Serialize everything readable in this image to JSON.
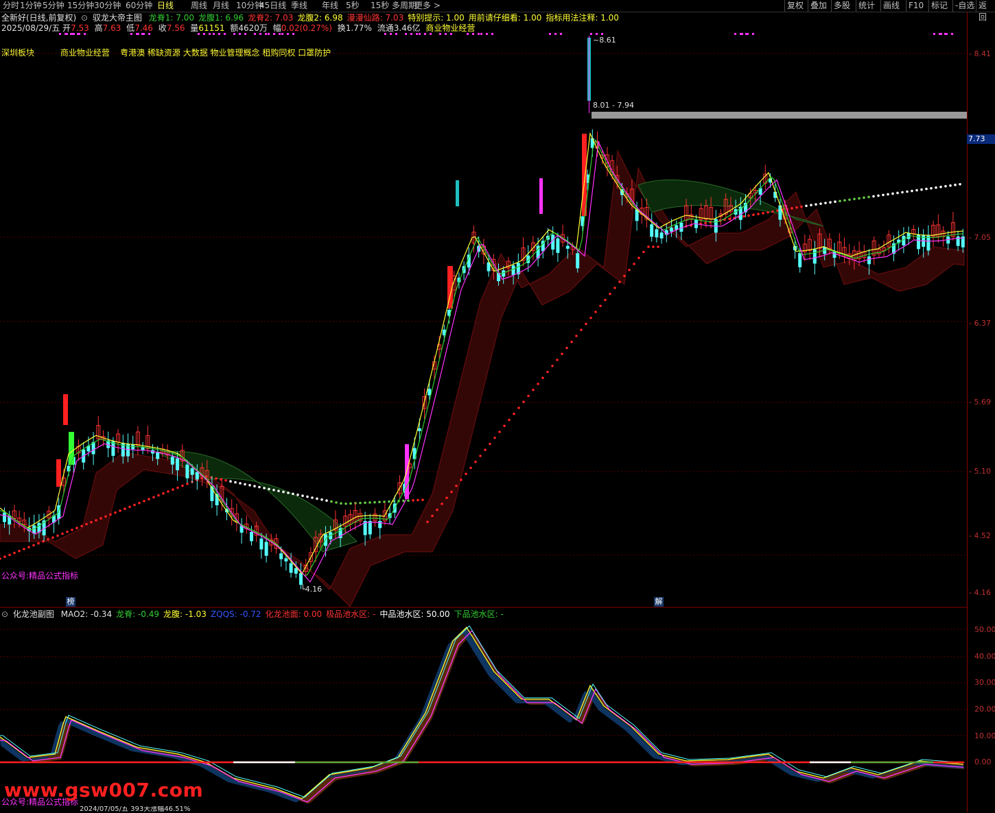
{
  "toolbar": {
    "periods": [
      "分时",
      "1分钟",
      "5分钟",
      "15分钟",
      "30分钟",
      "60分钟",
      "日线",
      "周线",
      "月线",
      "10分钟",
      "45日线",
      "季线",
      "年线",
      "5秒",
      "15秒",
      "多周期",
      "更多"
    ],
    "active_period": "日线",
    "right_buttons": [
      "复权",
      "叠加",
      "多股",
      "统计",
      "画线",
      "F10",
      "标记",
      "-自选",
      "返回"
    ]
  },
  "stock_header": {
    "title": "全新好(日线,前复权)",
    "indicator_name": "驭龙大帝主图",
    "params": [
      {
        "label": "龙脊1:",
        "value": "7.00",
        "color": "#33cc33"
      },
      {
        "label": "龙腹1:",
        "value": "6.96",
        "color": "#33cc33"
      },
      {
        "label": "龙脊2:",
        "value": "7.03",
        "color": "#ff3333"
      },
      {
        "label": "龙腹2:",
        "value": "6.98",
        "color": "#ffff33"
      },
      {
        "label": "漫漫仙路:",
        "value": "7.03",
        "color": "#ff3333"
      },
      {
        "label": "特别提示:",
        "value": "1.00",
        "color": "#ffff33"
      },
      {
        "label": "用前请仔细看:",
        "value": "1.00",
        "color": "#ffff33"
      },
      {
        "label": "指标用法注释:",
        "value": "1.00",
        "color": "#ffff33"
      }
    ]
  },
  "quote": {
    "date": "2025/08/29/五",
    "open_label": "开",
    "open": "7.53",
    "high_label": "高",
    "high": "7.63",
    "low_label": "低",
    "low": "7.46",
    "close_label": "收",
    "close": "7.56",
    "volume_label": "量",
    "volume": "61151",
    "amount_label": "额",
    "amount": "4620万",
    "change_label": "幅",
    "change": "0.02(0.27%)",
    "turnover_label": "换",
    "turnover": "1.77%",
    "float_label": "流通",
    "float": "3.46亿",
    "industry": "商业物业经营"
  },
  "sector_line": {
    "board": "深圳板块",
    "concepts": "商业物业经营    粤港澳 稀缺资源 大数据 物业管理概念 租购同权 口罩防护"
  },
  "main_annotations": {
    "peak_price": "8.61",
    "range_label": "8.01 - 7.94",
    "low_price": "4.16",
    "current_price_tag": "7.73",
    "watermark_main": "公众号:精品公式指标",
    "marker_left": "榜",
    "marker_right": "解"
  },
  "main_yaxis": [
    "8.41",
    "7.73",
    "7.05",
    "6.37",
    "5.69",
    "5.10",
    "4.52",
    "4.16"
  ],
  "sub_header": {
    "indicator_name": "化龙池副图",
    "params": [
      {
        "label": "MAO2:",
        "value": "-0.34",
        "color": "#e0e0e0"
      },
      {
        "label": "龙脊:",
        "value": "-0.49",
        "color": "#33cc33"
      },
      {
        "label": "龙腹:",
        "value": "-1.03",
        "color": "#ffff33"
      },
      {
        "label": "ZQQS:",
        "value": "-0.72",
        "color": "#3355ff"
      },
      {
        "label": "化龙池面:",
        "value": "0.00",
        "color": "#ff3333"
      },
      {
        "label": "极品池水区:",
        "value": "-",
        "color": "#ff3333"
      },
      {
        "label": "中品池水区:",
        "value": "50.00",
        "color": "#ffffff"
      },
      {
        "label": "下品池水区:",
        "value": "-",
        "color": "#33cc33"
      }
    ]
  },
  "sub_yaxis": [
    "50.00",
    "40.00",
    "30.00",
    "20.00",
    "10.00",
    "0.00"
  ],
  "sub_watermark": "公众号:精品公式指标",
  "site_watermark": "www.gsw007.com",
  "bottom_date_bar": "2024/07/05/五 393天涨幅46.51%",
  "colors": {
    "up": "#ff3333",
    "down": "#55ffff",
    "yellow": "#ffff33",
    "magenta": "#ff33ff",
    "dark_red": "#4a0000",
    "dark_green": "#0a3a0a"
  }
}
